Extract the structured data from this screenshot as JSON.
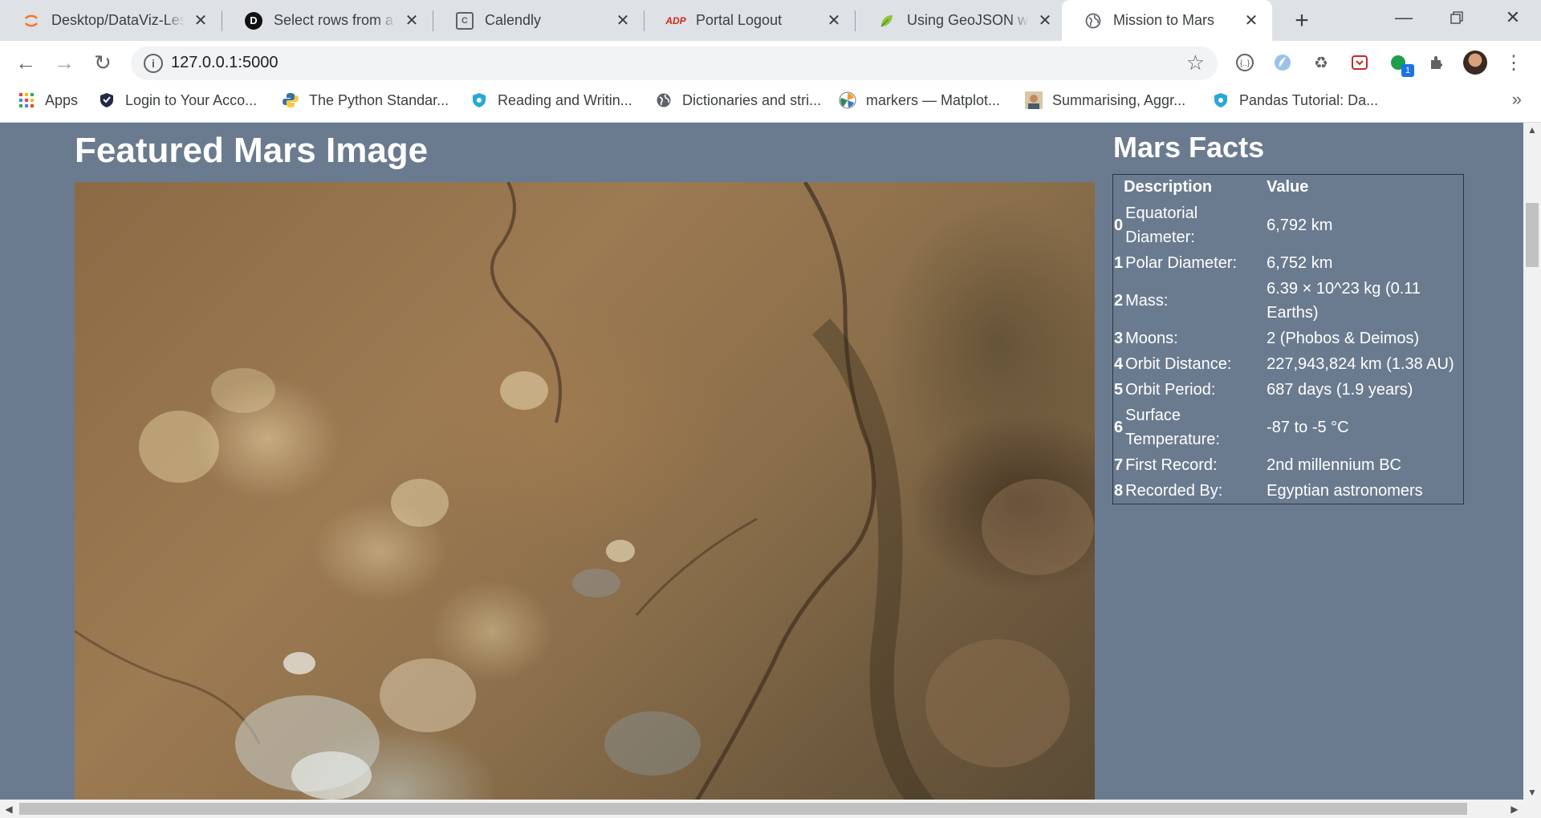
{
  "browser": {
    "tabs": [
      {
        "label": "Desktop/DataViz-Les",
        "icon": "jupyter-icon"
      },
      {
        "label": "Select rows from a Pa",
        "icon": "d-logo-icon"
      },
      {
        "label": "Calendly",
        "icon": "calendar-icon"
      },
      {
        "label": "Portal Logout",
        "icon": "adp-logo-icon"
      },
      {
        "label": "Using GeoJSON with",
        "icon": "leaf-icon"
      },
      {
        "label": "Mission to Mars",
        "icon": "globe-icon"
      }
    ],
    "address": {
      "url": "127.0.0.1:5000"
    },
    "extension_badge": "1",
    "bookmarks": [
      {
        "label": "Apps",
        "icon": "apps-grid-icon"
      },
      {
        "label": "Login to Your Acco...",
        "icon": "shield-check-icon"
      },
      {
        "label": "The Python Standar...",
        "icon": "python-icon"
      },
      {
        "label": "Reading and Writin...",
        "icon": "shield-icon"
      },
      {
        "label": "Dictionaries and stri...",
        "icon": "globe-icon"
      },
      {
        "label": "markers — Matplot...",
        "icon": "matplotlib-icon"
      },
      {
        "label": "Summarising, Aggr...",
        "icon": "portrait-icon"
      },
      {
        "label": "Pandas Tutorial: Da...",
        "icon": "shield-icon"
      }
    ]
  },
  "page": {
    "featured_title": "Featured Mars Image",
    "facts_title": "Mars Facts",
    "facts_table": {
      "headers": [
        "Description",
        "Value"
      ],
      "rows": [
        {
          "index": "0",
          "description": "Equatorial Diameter:",
          "value": "6,792 km"
        },
        {
          "index": "1",
          "description": "Polar Diameter:",
          "value": "6,752 km"
        },
        {
          "index": "2",
          "description": "Mass:",
          "value": "6.39 × 10^23 kg (0.11 Earths)"
        },
        {
          "index": "3",
          "description": "Moons:",
          "value": "2 (Phobos & Deimos)"
        },
        {
          "index": "4",
          "description": "Orbit Distance:",
          "value": "227,943,824 km (1.38 AU)"
        },
        {
          "index": "5",
          "description": "Orbit Period:",
          "value": "687 days (1.9 years)"
        },
        {
          "index": "6",
          "description": "Surface Temperature:",
          "value": "-87 to -5 °C"
        },
        {
          "index": "7",
          "description": "First Record:",
          "value": "2nd millennium BC"
        },
        {
          "index": "8",
          "description": "Recorded By:",
          "value": "Egyptian astronomers"
        }
      ]
    }
  },
  "colors": {
    "page_background": "#6b7b8f",
    "tabstrip": "#dee1e6",
    "active_tab": "#ffffff"
  }
}
